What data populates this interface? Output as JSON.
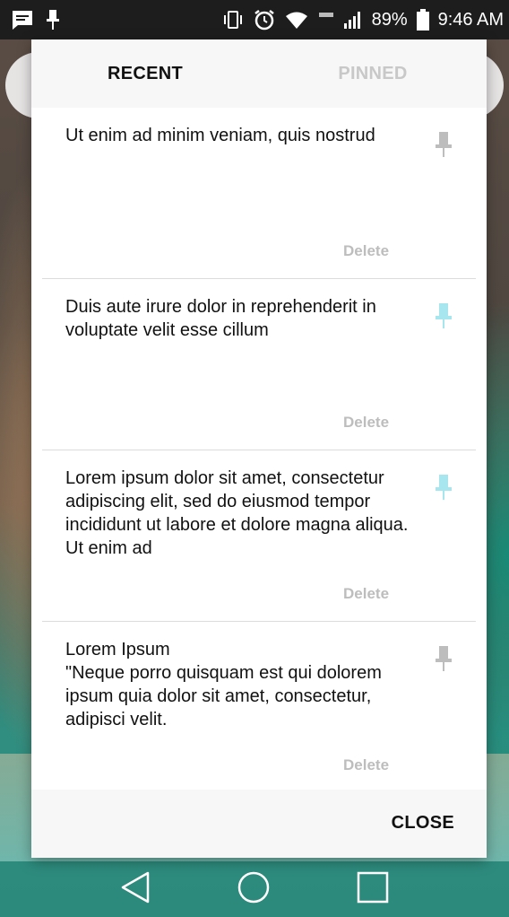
{
  "status_bar": {
    "battery_percent": "89%",
    "time": "9:46 AM",
    "icons": [
      "message-icon",
      "pin-icon",
      "vibrate-icon",
      "alarm-icon",
      "wifi-icon",
      "lte-icon",
      "signal-icon",
      "battery-icon"
    ]
  },
  "tabs": [
    {
      "label": "RECENT",
      "active": true
    },
    {
      "label": "PINNED",
      "active": false
    }
  ],
  "notes": [
    {
      "text": "Ut enim ad minim veniam, quis nostrud",
      "pinned": false,
      "delete_label": "Delete"
    },
    {
      "text": "Duis aute irure dolor in reprehenderit in voluptate velit esse cillum",
      "pinned": true,
      "delete_label": "Delete"
    },
    {
      "text": "Lorem ipsum dolor sit amet, consectetur adipiscing elit, sed do eiusmod tempor incididunt ut labore et dolore magna aliqua. Ut enim ad",
      "pinned": true,
      "delete_label": "Delete"
    },
    {
      "text": "Lorem Ipsum\n\"Neque porro quisquam est qui dolorem ipsum quia dolor sit amet, consectetur, adipisci velit.",
      "pinned": false,
      "delete_label": "Delete"
    }
  ],
  "footer": {
    "close_label": "CLOSE"
  },
  "colors": {
    "pin_active": "#a8e6ef",
    "pin_inactive": "#bdbdbd",
    "tab_inactive": "#c8c8c8"
  },
  "nav_bar": {
    "icons": [
      "back-icon",
      "home-icon",
      "recents-icon"
    ]
  }
}
